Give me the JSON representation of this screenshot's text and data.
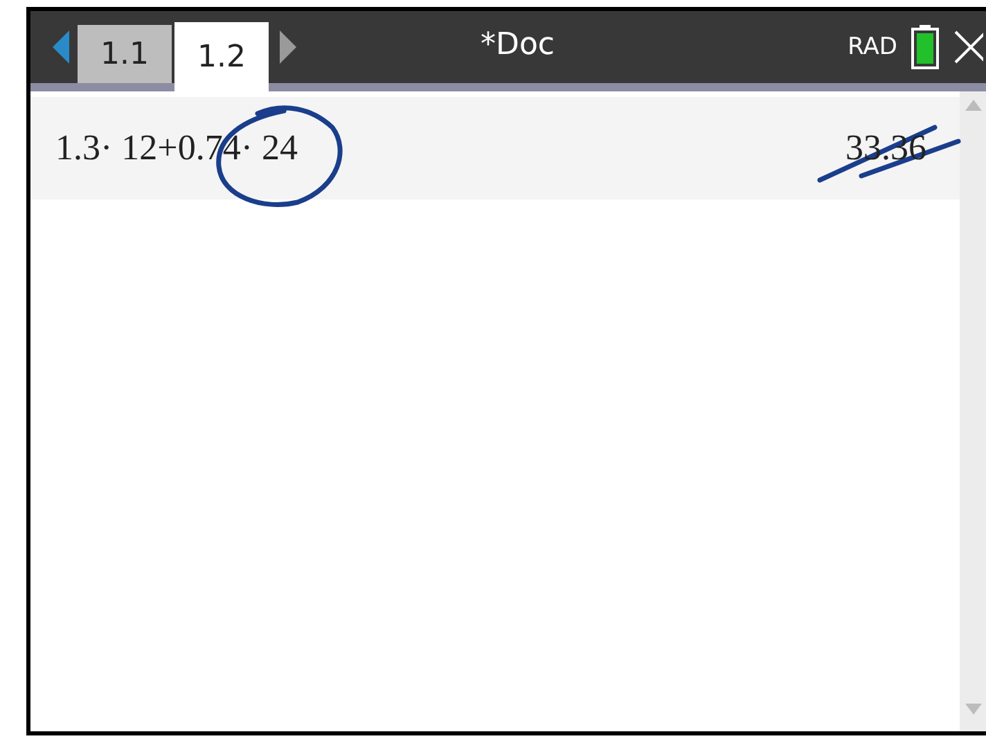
{
  "tabs": [
    {
      "label": "1.1",
      "selected": false
    },
    {
      "label": "1.2",
      "selected": true
    }
  ],
  "document_title": "*Doc",
  "angle_mode": "RAD",
  "calculations": [
    {
      "expression": "1.3· 12+0.74· 24",
      "result": "33.36"
    }
  ]
}
